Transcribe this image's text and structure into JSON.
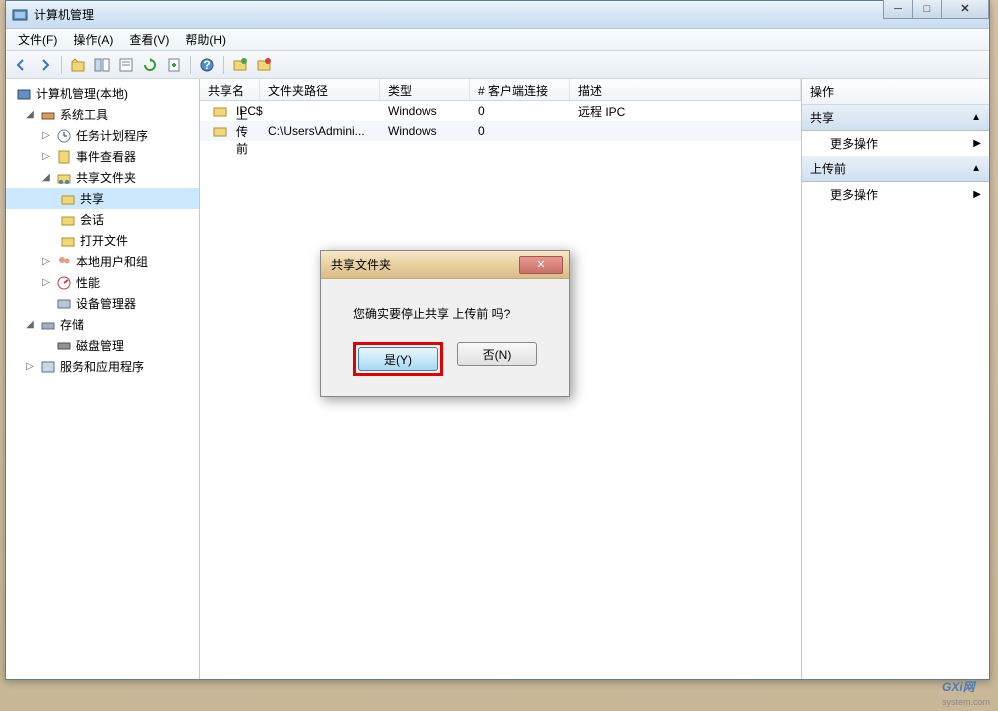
{
  "window": {
    "title": "计算机管理"
  },
  "menubar": {
    "file": "文件(F)",
    "action": "操作(A)",
    "view": "查看(V)",
    "help": "帮助(H)"
  },
  "tree": {
    "root": "计算机管理(本地)",
    "systools": "系统工具",
    "task": "任务计划程序",
    "event": "事件查看器",
    "shared": "共享文件夹",
    "share": "共享",
    "session": "会话",
    "openfile": "打开文件",
    "users": "本地用户和组",
    "perf": "性能",
    "devmgr": "设备管理器",
    "storage": "存储",
    "diskmgr": "磁盘管理",
    "services": "服务和应用程序"
  },
  "list": {
    "headers": {
      "name": "共享名",
      "path": "文件夹路径",
      "type": "类型",
      "clients": "# 客户端连接",
      "desc": "描述"
    },
    "rows": [
      {
        "name": "IPC$",
        "path": "",
        "type": "Windows",
        "clients": "0",
        "desc": "远程 IPC"
      },
      {
        "name": "上传前",
        "path": "C:\\Users\\Admini...",
        "type": "Windows",
        "clients": "0",
        "desc": ""
      }
    ]
  },
  "actions": {
    "title": "操作",
    "section1": "共享",
    "more1": "更多操作",
    "section2": "上传前",
    "more2": "更多操作"
  },
  "dialog": {
    "title": "共享文件夹",
    "message": "您确实要停止共享 上传前 吗?",
    "yes": "是(Y)",
    "no": "否(N)"
  },
  "watermark": {
    "main": "GXi网",
    "sub": "system.com"
  }
}
